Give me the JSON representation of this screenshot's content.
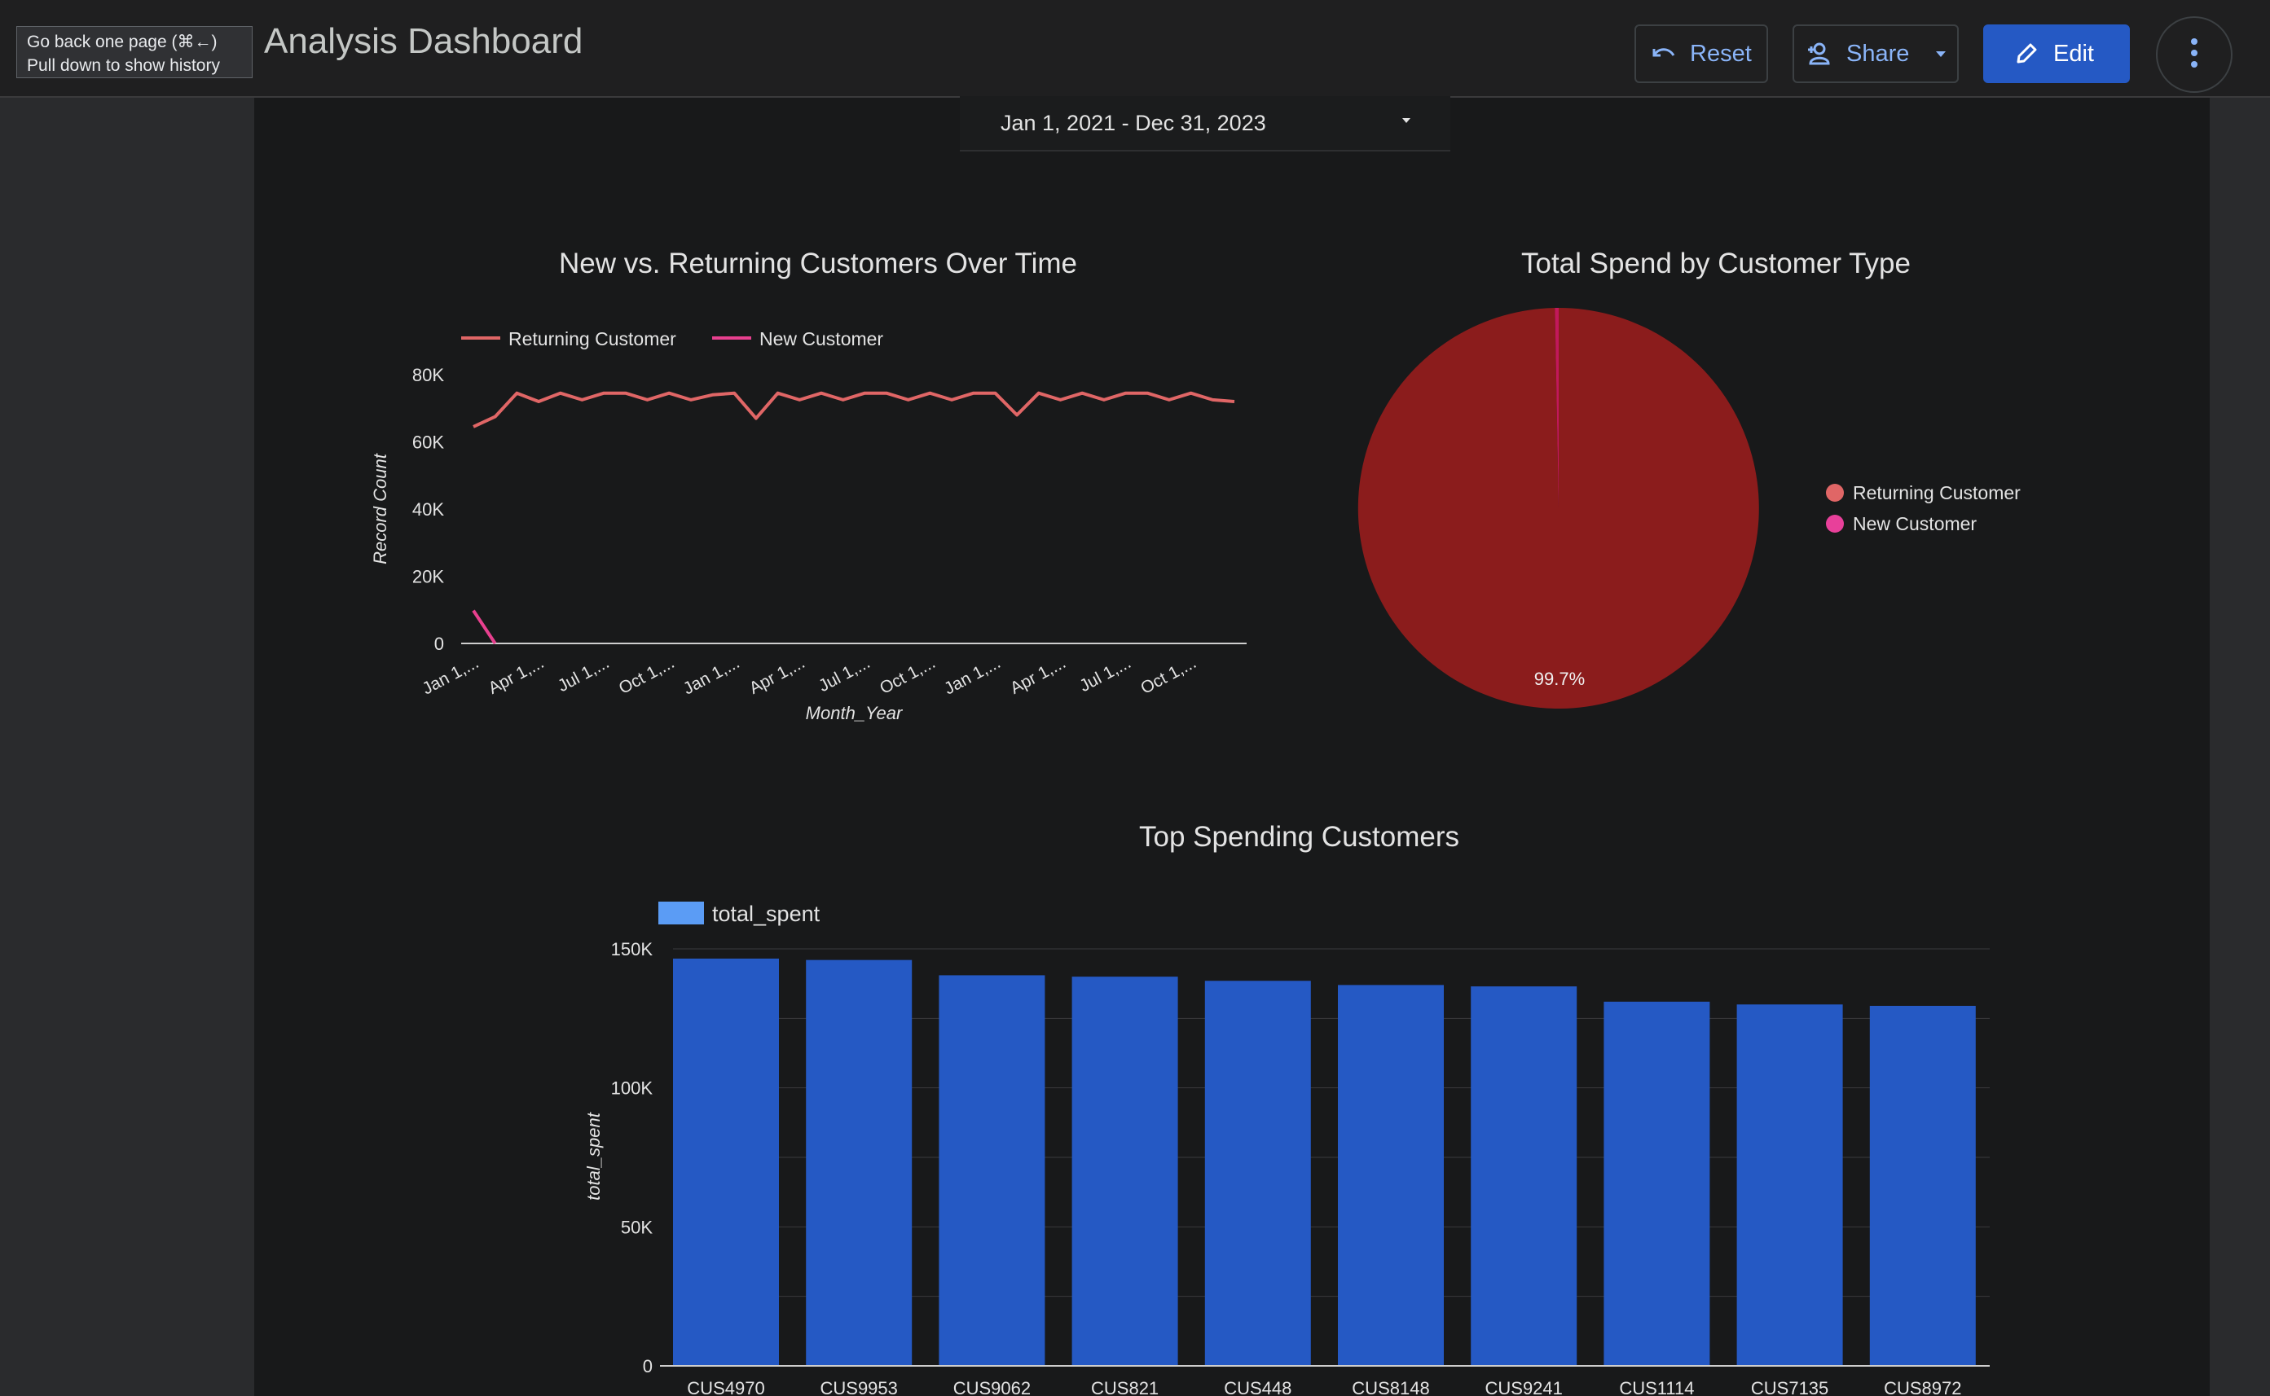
{
  "browser": {
    "tooltip_line1": "Go back one page (⌘←)",
    "tooltip_line2": "Pull down to show history"
  },
  "header": {
    "title": "Analysis Dashboard",
    "reset_label": "Reset",
    "share_label": "Share",
    "edit_label": "Edit"
  },
  "filters": {
    "date_range": "Jan 1, 2021 - Dec 31, 2023"
  },
  "colors": {
    "accent": "#8ab4f8",
    "edit_button": "#2559c4",
    "returning_line": "#e06666",
    "new_line": "#e8408f",
    "pie_returning": "#8b1c1c",
    "pie_new": "#c2185b",
    "legend_returning": "#e06666",
    "legend_new": "#e8409a",
    "bar": "#2559c4",
    "bar_legend": "#5b9cf5"
  },
  "icons": {
    "reset": "undo-icon",
    "share": "person-add-icon",
    "share_menu": "caret-down-icon",
    "edit": "pencil-icon",
    "more": "more-vert-icon",
    "date_dropdown": "caret-down-icon"
  },
  "chart_data": [
    {
      "type": "line",
      "title": "New vs. Returning Customers Over Time",
      "xlabel": "Month_Year",
      "ylabel": "Record Count",
      "ylim": [
        0,
        80000
      ],
      "yticks": [
        "0",
        "20K",
        "40K",
        "60K",
        "80K"
      ],
      "x_tick_labels": [
        "Jan 1,...",
        "Apr 1,...",
        "Jul 1,...",
        "Oct 1,...",
        "Jan 1,...",
        "Apr 1,...",
        "Jul 1,...",
        "Oct 1,...",
        "Jan 1,...",
        "Apr 1,...",
        "Jul 1,...",
        "Oct 1,..."
      ],
      "legend_position": "top-left",
      "series": [
        {
          "name": "Returning Customer",
          "values": [
            64500,
            67500,
            74500,
            72000,
            74500,
            72500,
            74500,
            74500,
            72500,
            74500,
            72500,
            74000,
            74500,
            67000,
            74500,
            72500,
            74500,
            72500,
            74500,
            74500,
            72500,
            74500,
            72500,
            74500,
            74500,
            68000,
            74500,
            72500,
            74500,
            72500,
            74500,
            74500,
            72500,
            74500,
            72500,
            72000
          ]
        },
        {
          "name": "New Customer",
          "values": [
            9800,
            0
          ]
        }
      ]
    },
    {
      "type": "pie",
      "title": "Total Spend by Customer Type",
      "legend_position": "right",
      "slices": [
        {
          "name": "Returning Customer",
          "value": 99.7,
          "label": "99.7%"
        },
        {
          "name": "New Customer",
          "value": 0.3
        }
      ]
    },
    {
      "type": "bar",
      "title": "Top Spending Customers",
      "xlabel": "",
      "ylabel": "total_spent",
      "ylim": [
        0,
        150000
      ],
      "yticks": [
        "0",
        "50K",
        "100K",
        "150K"
      ],
      "legend_position": "top-left",
      "categories": [
        "CUS4970",
        "CUS9953",
        "CUS9062",
        "CUS821",
        "CUS448",
        "CUS8148",
        "CUS9241",
        "CUS1114",
        "CUS7135",
        "CUS8972"
      ],
      "series": [
        {
          "name": "total_spent",
          "values": [
            146500,
            146000,
            140500,
            140000,
            138500,
            137000,
            136500,
            131000,
            130000,
            129500
          ]
        }
      ]
    }
  ]
}
